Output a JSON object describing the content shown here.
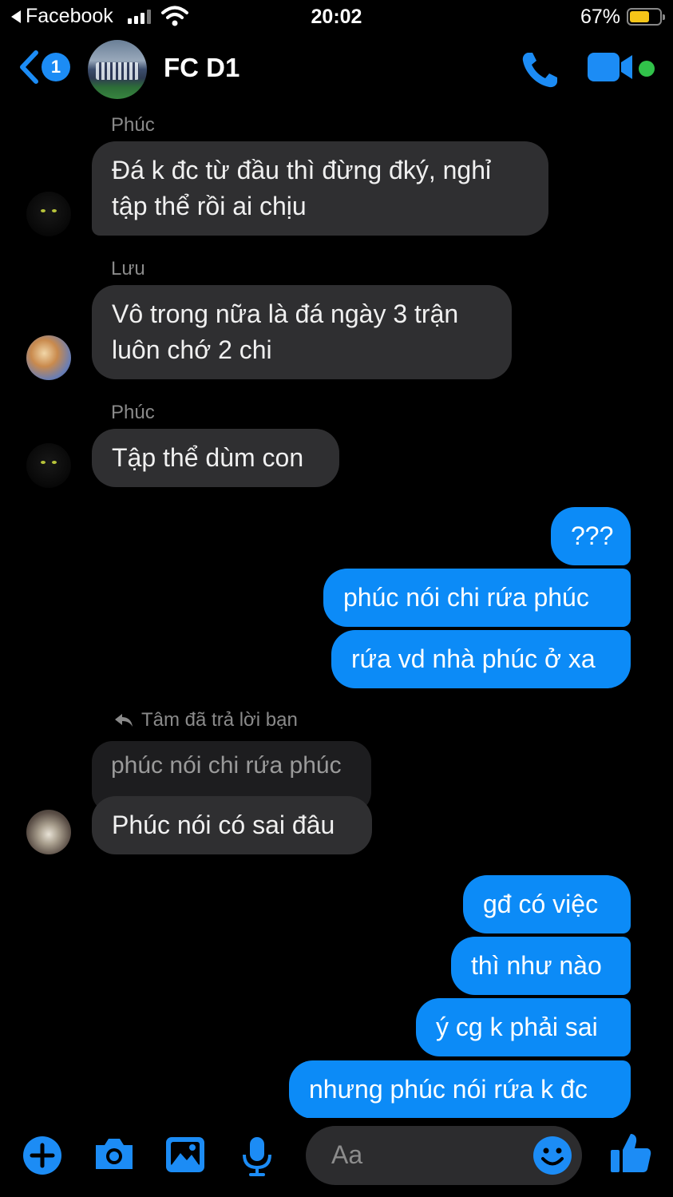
{
  "status_bar": {
    "back_app": "Facebook",
    "time": "20:02",
    "battery_percent": "67%",
    "battery_level": 0.67
  },
  "header": {
    "unread_count": "1",
    "title": "FC D1",
    "icons": [
      "back-chevron-icon",
      "phone-icon",
      "video-camera-icon"
    ],
    "accent_color": "#0c8bf7",
    "online_color": "#31c24a"
  },
  "messages": [
    {
      "side": "in",
      "sender": "Phúc",
      "lines": [
        "Đá k đc từ đầu thì đừng đký, nghỉ",
        "tập thể rồi ai chịu"
      ]
    },
    {
      "side": "in",
      "sender": "Lưu",
      "lines": [
        "Vô trong nữa là đá ngày 3 trận",
        "luôn chớ 2 chi"
      ]
    },
    {
      "side": "in",
      "sender": "Phúc",
      "lines": [
        "Tập thể dùm con"
      ]
    },
    {
      "side": "out",
      "lines": [
        "???"
      ]
    },
    {
      "side": "out",
      "lines": [
        "phúc nói chi rứa phúc"
      ]
    },
    {
      "side": "out",
      "lines": [
        "rứa vd nhà phúc ở xa"
      ]
    },
    {
      "side": "in",
      "reply_note": "Tâm đã trả lời bạn",
      "quoted": "phúc nói chi rứa phúc",
      "lines": [
        "Phúc nói có sai đâu"
      ]
    },
    {
      "side": "out",
      "lines": [
        "gđ có việc"
      ]
    },
    {
      "side": "out",
      "lines": [
        "thì như nào"
      ]
    },
    {
      "side": "out",
      "lines": [
        "ý cg k phải sai"
      ]
    },
    {
      "side": "out",
      "lines": [
        "nhưng phúc nói rứa k đc"
      ]
    }
  ],
  "composer": {
    "placeholder": "Aa",
    "icons": [
      "plus-icon",
      "camera-icon",
      "image-icon",
      "microphone-icon",
      "emoji-icon",
      "thumbs-up-icon"
    ]
  }
}
